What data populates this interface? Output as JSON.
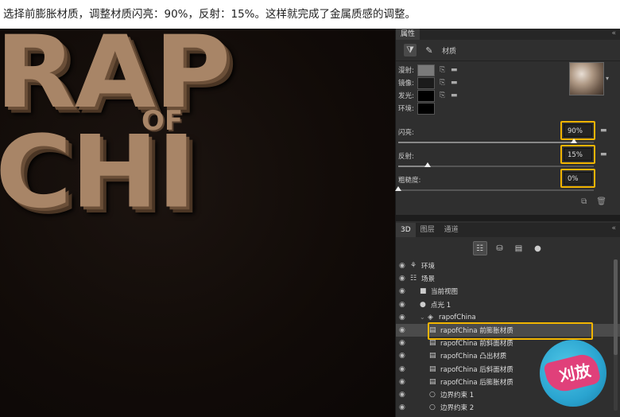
{
  "caption": "选择前膨胀材质，调整材质闪亮：90%，反射：15%。这样就完成了金属质感的调整。",
  "artwork": {
    "main_text": "RAP CHI",
    "of_text": "OF"
  },
  "properties_panel": {
    "title": "属性",
    "collapse": "«",
    "tab_label": "材质",
    "textures": [
      {
        "label": "漫射:",
        "color": "#7a7a7a"
      },
      {
        "label": "镜像:",
        "color": "#1b1b1b"
      },
      {
        "label": "发光:",
        "color": "#000000"
      },
      {
        "label": "环境:",
        "color": "#000000"
      }
    ],
    "props": [
      {
        "name": "闪亮:",
        "value": "90%",
        "percent": 90
      },
      {
        "name": "反射:",
        "value": "15%",
        "percent": 15
      },
      {
        "name": "粗糙度:",
        "value": "0%",
        "percent": 0
      }
    ],
    "highlight_color": "#f1b400"
  },
  "panel2": {
    "tabs": [
      "3D",
      "图层",
      "通道"
    ],
    "collapse": "«",
    "scene_items": [
      {
        "label": "环境",
        "icon": "environment-icon",
        "glyph": "⚘",
        "indent": 0,
        "selected": false
      },
      {
        "label": "场景",
        "icon": "scene-icon",
        "glyph": "☷",
        "indent": 0,
        "selected": false
      },
      {
        "label": "当前视图",
        "icon": "camera-icon",
        "glyph": "■",
        "indent": 1,
        "selected": false
      },
      {
        "label": "点光 1",
        "icon": "light-bulb-icon",
        "glyph": "●",
        "indent": 1,
        "selected": false
      },
      {
        "label": "rapofChina",
        "icon": "mesh-icon",
        "glyph": "◈",
        "indent": 1,
        "selected": false,
        "chevron": "⌄"
      },
      {
        "label": "rapofChina 前膨胀材质",
        "icon": "material-icon",
        "glyph": "▤",
        "indent": 2,
        "selected": true
      },
      {
        "label": "rapofChina 前斜面材质",
        "icon": "material-icon",
        "glyph": "▤",
        "indent": 2,
        "selected": false
      },
      {
        "label": "rapofChina 凸出材质",
        "icon": "material-icon",
        "glyph": "▤",
        "indent": 2,
        "selected": false
      },
      {
        "label": "rapofChina 后斜面材质",
        "icon": "material-icon",
        "glyph": "▤",
        "indent": 2,
        "selected": false
      },
      {
        "label": "rapofChina 后膨胀材质",
        "icon": "material-icon",
        "glyph": "▤",
        "indent": 2,
        "selected": false
      },
      {
        "label": "边界约束 1",
        "icon": "constraint-icon",
        "glyph": "○",
        "indent": 2,
        "selected": false
      },
      {
        "label": "边界约束 2",
        "icon": "constraint-icon",
        "glyph": "○",
        "indent": 2,
        "selected": false
      }
    ]
  },
  "logo": {
    "text": "刈放"
  }
}
